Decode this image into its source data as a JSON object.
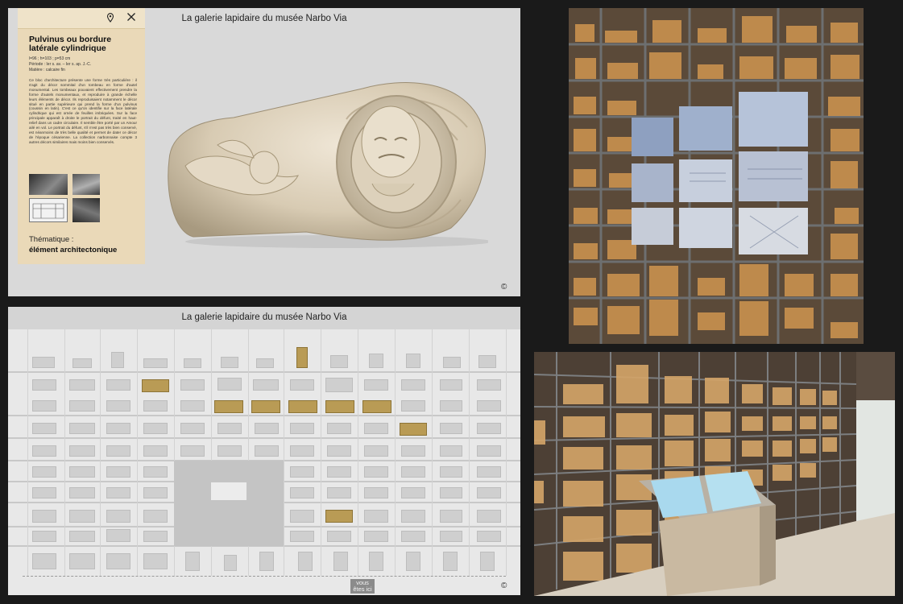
{
  "top_panel": {
    "title": "La galerie lapidaire du musée Narbo Via",
    "copyright": "©",
    "card": {
      "heading": "Pulvinus ou bordure latérale cylindrique",
      "dims": "l=96 ; h=103 ; p=53 cm",
      "period": "Période : Ier s. av. – Ier s. ap. J.-C.",
      "material": "Matière : calcaire fin",
      "description": "Ce bloc d'architecture présente une forme très particulière : il s'agit du décor sommital d'un tombeau en forme d'autel monumental. Les tombeaux pouvaient effectivement prendre la forme d'autels monumentaux, et reproduire à grande échelle leurs éléments de décor. Ils reproduisaient notamment le décor situé en partie supérieure qui prend la forme d'un pulvinus (coussin en latin). C'est ce qu'on identifie sur la face latérale cylindrique qui est ornée de feuilles imbriquées. Sur la face principale apparaît à droite le portrait du défunt, traité en haut-relief dans un cadre circulaire. Il semble être porté par un Amour ailé en vol. Le portrait du défunt, s'il n'est pas très bien conservé, est néanmoins de très belle qualité et permet de dater ce décor de l'époque césarienne. La collection narbonnaise compte 3 autres décors similaires mais moins bien conservés.",
      "theme_label": "Thématique :",
      "theme_value": "élément architectonique"
    }
  },
  "bottom_panel": {
    "title": "La galerie lapidaire du musée Narbo Via",
    "here_label": "vous êtes ici",
    "copyright": "©"
  },
  "icons": {
    "pin": "location-pin-icon",
    "close": "close-icon"
  },
  "colors": {
    "card_bg": "#ead9b8",
    "highlight": "#b99b55",
    "grid_bg": "#e8e8e8"
  }
}
